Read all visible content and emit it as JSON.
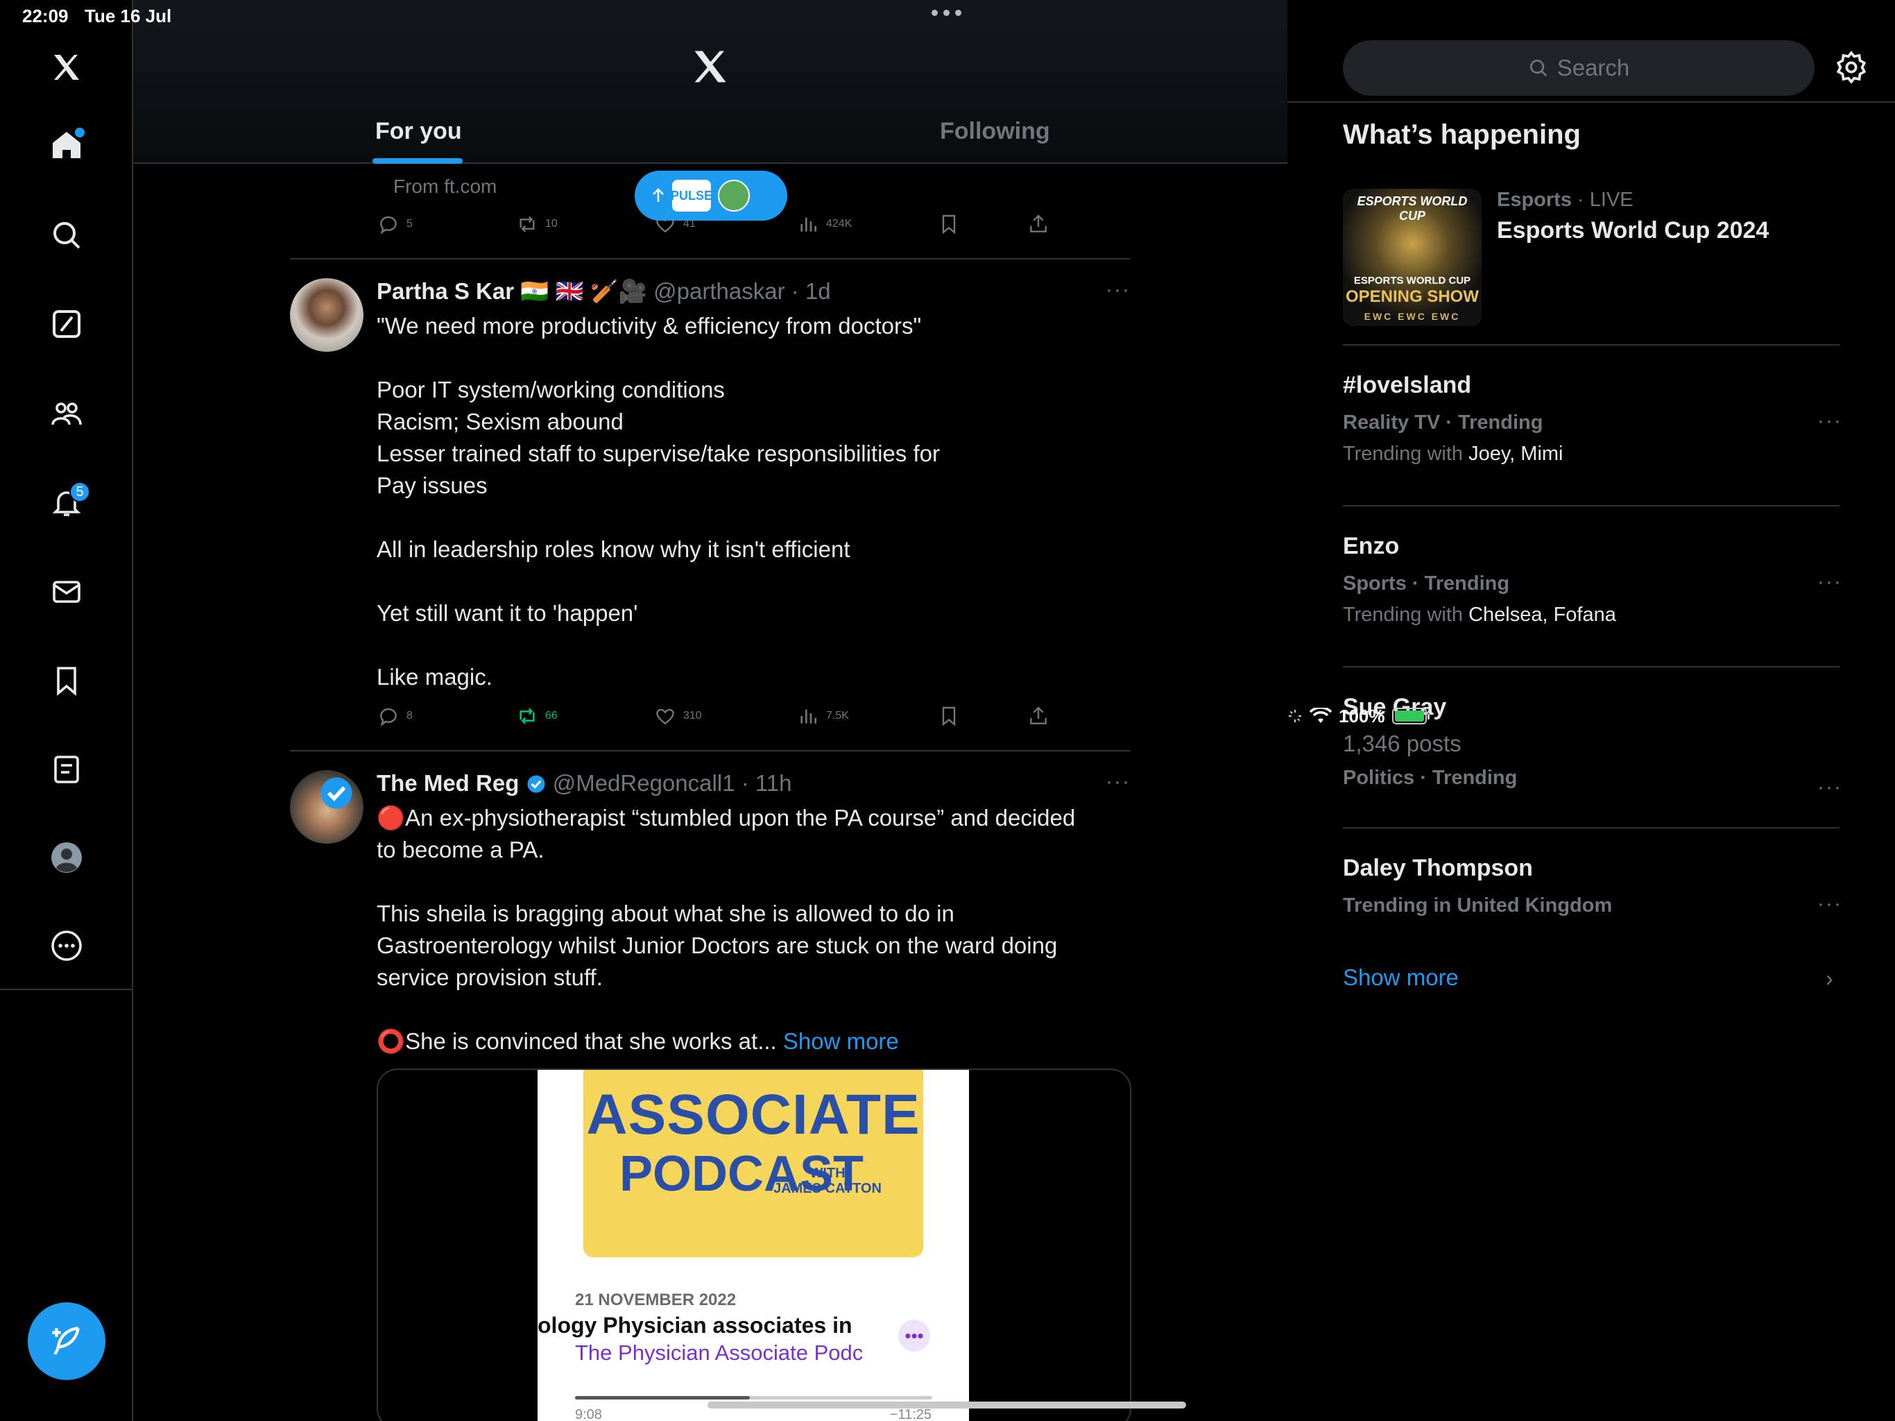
{
  "status_bar": {
    "time": "22:09",
    "date": "Tue 16 Jul",
    "battery": "100%"
  },
  "nav": {
    "notifications_badge": "5"
  },
  "header": {
    "tabs": [
      {
        "label": "For you"
      },
      {
        "label": "Following"
      }
    ]
  },
  "pulse_pill": {
    "label": "PULSE"
  },
  "prev_tweet": {
    "from": "From ft.com",
    "replies": "5",
    "reposts": "10",
    "likes": "41",
    "views": "424K"
  },
  "tweet1": {
    "name": "Partha S Kar",
    "emojis": "🇮🇳 🇬🇧 🏏🎥",
    "handle": "@parthaskar",
    "time": "· 1d",
    "lines": [
      "\"We need more productivity & efficiency from doctors\"",
      "",
      "Poor IT system/working conditions",
      "Racism; Sexism abound",
      "Lesser trained staff to supervise/take responsibilities for",
      "Pay issues",
      "",
      "All in leadership roles know why it isn't efficient",
      "",
      "Yet still want it to 'happen'",
      "",
      "Like magic."
    ],
    "replies": "8",
    "reposts": "66",
    "likes": "310",
    "views": "7.5K"
  },
  "tweet2": {
    "name": "The Med Reg",
    "handle": "@MedRegoncall1",
    "time": "· 11h",
    "lines": [
      "🔴An ex-physiotherapist “stumbled upon the PA course” and decided",
      "to become a PA.",
      "",
      "This sheila is bragging about what she is allowed to do in",
      "Gastroenterology whilst Junior Doctors are stuck on the ward doing",
      "service provision stuff.",
      ""
    ],
    "last_line": "⭕She is convinced that she works at...",
    "show_more": "Show more",
    "media": {
      "cover_line1": "ASSOCIATE",
      "cover_line2": "PODCAST",
      "cover_with": "WITH",
      "cover_host": "JAMES CATTON",
      "date": "21 NOVEMBER 2022",
      "title": "ology    Physician associates in",
      "show": "The Physician Associate Podc",
      "elapsed": "9:08",
      "remaining": "−11:25",
      "progress": 0.49
    }
  },
  "right": {
    "search_placeholder": "Search",
    "title": "What’s happening",
    "esports": {
      "category": "Esports",
      "live": "· LIVE",
      "name": "Esports World Cup 2024",
      "thumb_top": "ESPORTS WORLD CUP",
      "thumb_mid": "ESPORTS WORLD CUP",
      "thumb_big": "OPENING SHOW",
      "thumb_bottom": "EWC EWC EWC"
    },
    "trends": [
      {
        "name": "#loveIsland",
        "category": "Reality TV · Trending",
        "with_label": "Trending with",
        "with": "Joey, Mimi"
      },
      {
        "name": "Enzo",
        "category": "Sports · Trending",
        "with_label": "Trending with",
        "with": "Chelsea, Fofana"
      },
      {
        "name": "Sue Gray",
        "posts": "1,346 posts",
        "category": "Politics · Trending"
      },
      {
        "name": "Daley Thompson",
        "category": "Trending in United Kingdom"
      }
    ],
    "show_more": "Show more"
  },
  "colors": {
    "accent": "#1d9bf0",
    "repost_active": "#00ba7c",
    "background": "#000000",
    "muted": "#71767b"
  }
}
